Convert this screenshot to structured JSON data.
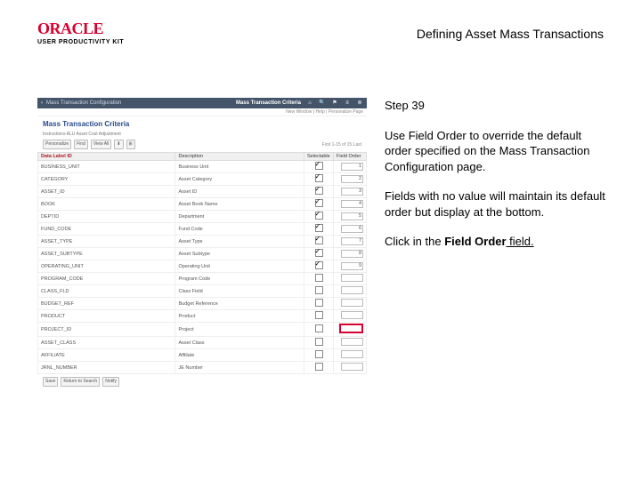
{
  "doc": {
    "title": "Defining Asset Mass Transactions"
  },
  "logo": {
    "brand": "ORACLE",
    "sub": "USER PRODUCTIVITY KIT"
  },
  "instr": {
    "step": "Step 39",
    "p1": "Use Field Order to override the default order specified on the Mass Transaction Configuration page.",
    "p2": "Fields with no value will maintain its default order but display at the bottom.",
    "p3a": "Click in the ",
    "p3b": "Field Order",
    "p3c": " field."
  },
  "shot": {
    "crumb_back": "‹",
    "crumb1": "Mass Transaction Configuration",
    "crumb2": "Mass Transaction Criteria",
    "icons": {
      "home": "⌂",
      "search": "🔍",
      "flag": "⚑",
      "menu": "≡",
      "gear": "⊚"
    },
    "meta": "New Window | Help | Personalize Page",
    "subtitle": "Mass Transaction Criteria",
    "inst": "Instructions  ALU   Asset Cost Adjustment",
    "btns": {
      "pers": "Personalize",
      "find": "Find",
      "viewall": "View All",
      "dl": "⬇",
      "xl": "⊞"
    },
    "count": "First  1-15 of 15  Last",
    "headers": {
      "c1": "Data Label ID",
      "c2": "Description",
      "c3": "Selectable",
      "c4": "Field Order"
    },
    "rows": [
      {
        "id": "BUSINESS_UNIT",
        "desc": "Business Unit",
        "chk": true,
        "ord": "1"
      },
      {
        "id": "CATEGORY",
        "desc": "Asset Category",
        "chk": true,
        "ord": "2"
      },
      {
        "id": "ASSET_ID",
        "desc": "Asset ID",
        "chk": true,
        "ord": "3"
      },
      {
        "id": "BOOK",
        "desc": "Asset Book Name",
        "chk": true,
        "ord": "4"
      },
      {
        "id": "DEPTID",
        "desc": "Department",
        "chk": true,
        "ord": "5"
      },
      {
        "id": "FUND_CODE",
        "desc": "Fund Code",
        "chk": true,
        "ord": "6"
      },
      {
        "id": "ASSET_TYPE",
        "desc": "Asset Type",
        "chk": true,
        "ord": "7"
      },
      {
        "id": "ASSET_SUBTYPE",
        "desc": "Asset Subtype",
        "chk": true,
        "ord": "8"
      },
      {
        "id": "OPERATING_UNIT",
        "desc": "Operating Unit",
        "chk": true,
        "ord": "9"
      },
      {
        "id": "PROGRAM_CODE",
        "desc": "Program Code",
        "chk": false,
        "ord": ""
      },
      {
        "id": "CLASS_FLD",
        "desc": "Class Field",
        "chk": false,
        "ord": ""
      },
      {
        "id": "BUDGET_REF",
        "desc": "Budget Reference",
        "chk": false,
        "ord": ""
      },
      {
        "id": "PRODUCT",
        "desc": "Product",
        "chk": false,
        "ord": ""
      },
      {
        "id": "PROJECT_ID",
        "desc": "Project",
        "chk": false,
        "ord": "",
        "hi": true
      },
      {
        "id": "ASSET_CLASS",
        "desc": "Asset Class",
        "chk": false,
        "ord": ""
      },
      {
        "id": "AFFILIATE",
        "desc": "Affiliate",
        "chk": false,
        "ord": ""
      },
      {
        "id": "JRNL_NUMBER",
        "desc": "JE Number",
        "chk": false,
        "ord": ""
      }
    ],
    "footer": {
      "save": "Save",
      "ret": "Return to Search",
      "notify": "Notify"
    }
  }
}
